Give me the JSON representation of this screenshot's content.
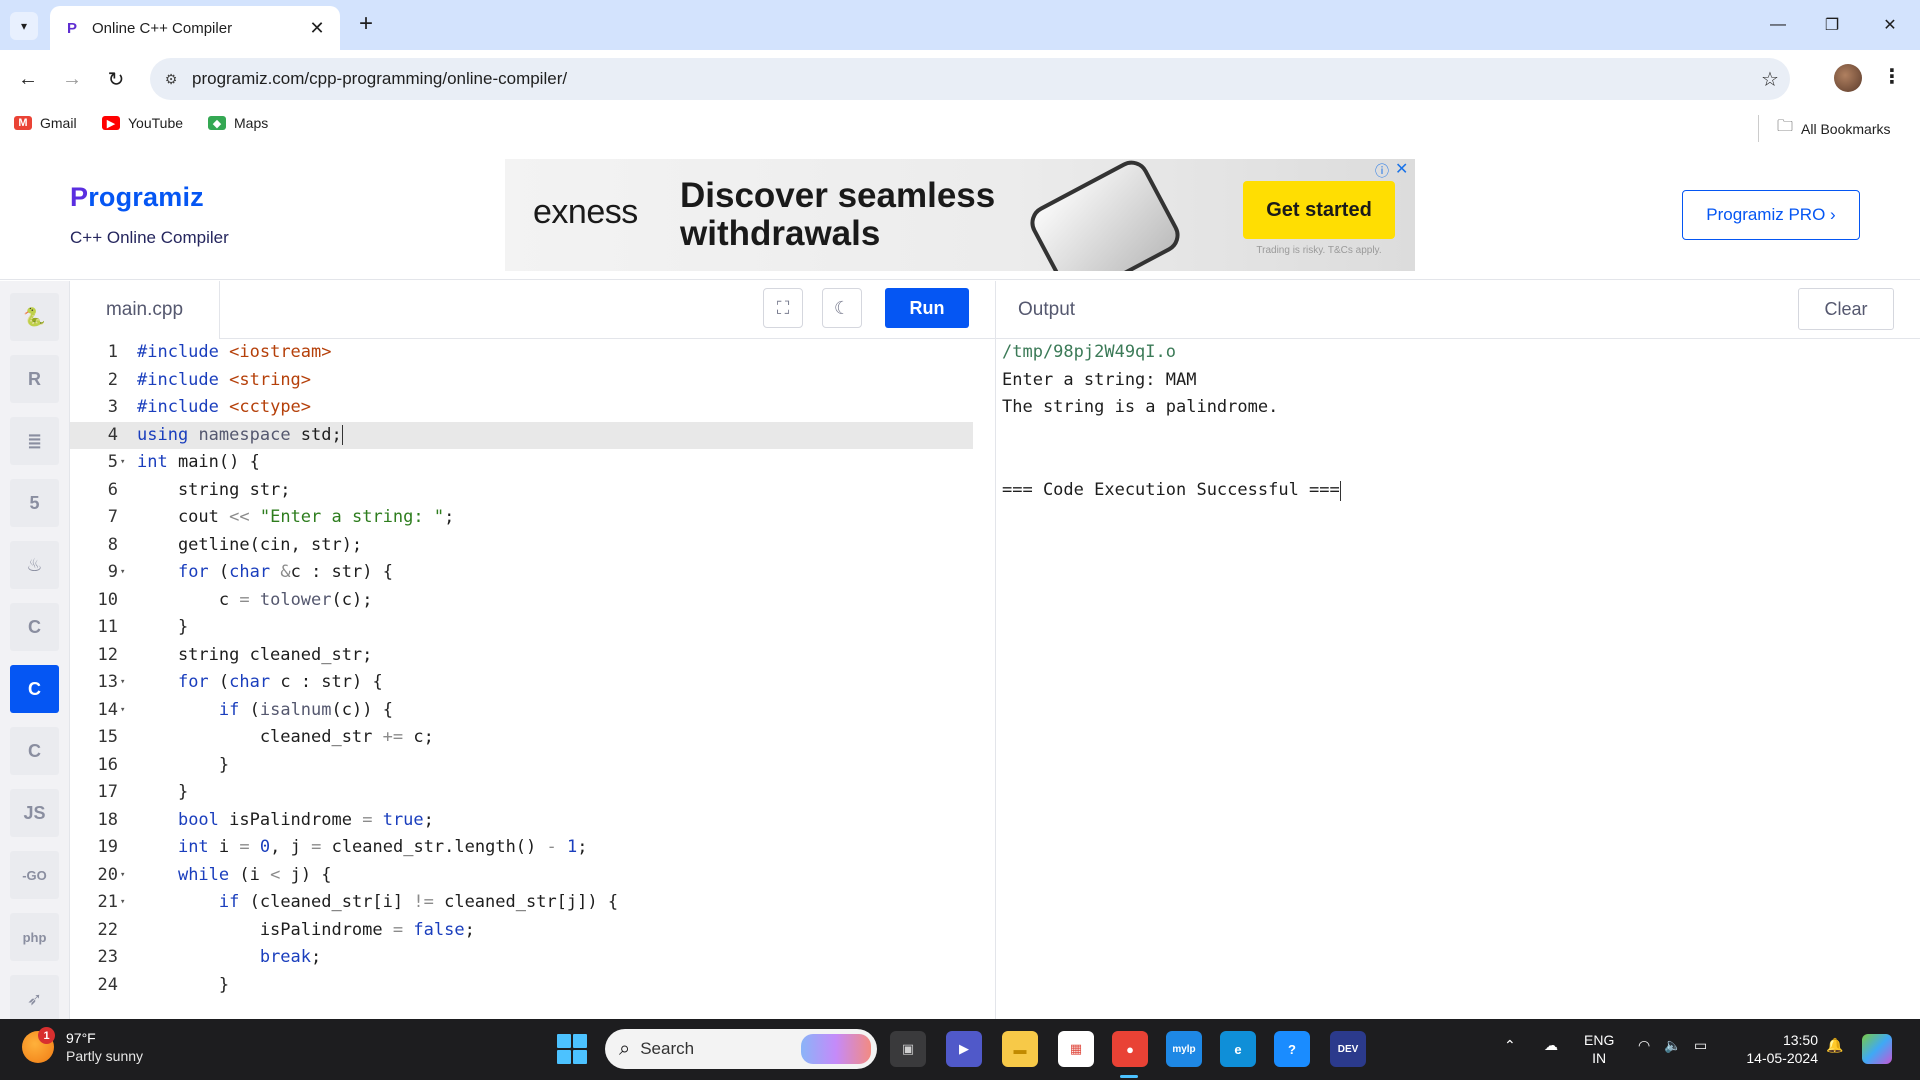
{
  "browser": {
    "tab_title": "Online C++ Compiler",
    "tab_close": "✕",
    "new_tab": "+",
    "url": "programiz.com/cpp-programming/online-compiler/",
    "bookmarks": [
      {
        "label": "Gmail",
        "icon": "gmail-icon",
        "color": "#ea4335"
      },
      {
        "label": "YouTube",
        "icon": "youtube-icon",
        "color": "#ff0000"
      },
      {
        "label": "Maps",
        "icon": "maps-icon",
        "color": "#34a853"
      }
    ],
    "all_bookmarks": "All Bookmarks"
  },
  "site": {
    "logo": "rogramiz",
    "logo_p": "P",
    "subtitle": "C++ Online Compiler",
    "pro_button": "Programiz PRO ›",
    "accent": "#0556f3"
  },
  "ad": {
    "brand": "exness",
    "headline": "Discover seamless withdrawals",
    "cta": "Get started",
    "disclaimer": "Trading is risky. T&Cs apply.",
    "cta_color": "#ffde02"
  },
  "languages": [
    {
      "name": "python",
      "icon": "python-icon",
      "glyph": "🐍"
    },
    {
      "name": "r",
      "icon": "r-icon",
      "glyph": "R"
    },
    {
      "name": "sql",
      "icon": "database-icon",
      "glyph": "≣"
    },
    {
      "name": "html",
      "icon": "html5-icon",
      "glyph": "5"
    },
    {
      "name": "java",
      "icon": "java-icon",
      "glyph": "♨"
    },
    {
      "name": "c",
      "icon": "c-icon",
      "glyph": "C"
    },
    {
      "name": "cpp",
      "icon": "cpp-icon",
      "glyph": "C",
      "active": true
    },
    {
      "name": "csharp",
      "icon": "csharp-icon",
      "glyph": "C"
    },
    {
      "name": "js",
      "icon": "js-icon",
      "glyph": "JS"
    },
    {
      "name": "go",
      "icon": "go-icon",
      "glyph": "-GO"
    },
    {
      "name": "php",
      "icon": "php-icon",
      "glyph": "php"
    },
    {
      "name": "swift",
      "icon": "swift-icon",
      "glyph": "➶"
    }
  ],
  "editor": {
    "file_name": "main.cpp",
    "run_label": "Run",
    "active_line": 4,
    "lines": [
      {
        "n": "1",
        "fold": false,
        "html": "<span class=\"dir\">#include</span> <span class=\"str\">&lt;iostream&gt;</span>"
      },
      {
        "n": "2",
        "fold": false,
        "html": "<span class=\"dir\">#include</span> <span class=\"str\">&lt;string&gt;</span>"
      },
      {
        "n": "3",
        "fold": false,
        "html": "<span class=\"dir\">#include</span> <span class=\"str\">&lt;cctype&gt;</span>"
      },
      {
        "n": "4",
        "fold": false,
        "html": "<span class=\"kw\">using</span> <span class=\"fn\">namespace</span> std;<span class=\"caret\"></span>"
      },
      {
        "n": "5",
        "fold": true,
        "html": "<span class=\"kw\">int</span> main() {"
      },
      {
        "n": "6",
        "fold": false,
        "html": "    string str;"
      },
      {
        "n": "7",
        "fold": false,
        "html": "    cout <span class=\"op\">&lt;&lt;</span> <span class=\"strg\">\"Enter a string: \"</span>;"
      },
      {
        "n": "8",
        "fold": false,
        "html": "    getline(cin, str);"
      },
      {
        "n": "9",
        "fold": true,
        "html": "    <span class=\"kw\">for</span> (<span class=\"kw\">char</span> <span class=\"op\">&amp;</span>c : str) {"
      },
      {
        "n": "10",
        "fold": false,
        "html": "        c <span class=\"op\">=</span> <span class=\"fn\">tolower</span>(c);"
      },
      {
        "n": "11",
        "fold": false,
        "html": "    }"
      },
      {
        "n": "12",
        "fold": false,
        "html": "    string cleaned_str;"
      },
      {
        "n": "13",
        "fold": true,
        "html": "    <span class=\"kw\">for</span> (<span class=\"kw\">char</span> c : str) {"
      },
      {
        "n": "14",
        "fold": true,
        "html": "        <span class=\"kw\">if</span> (<span class=\"fn\">isalnum</span>(c)) {"
      },
      {
        "n": "15",
        "fold": false,
        "html": "            cleaned_str <span class=\"op\">+=</span> c;"
      },
      {
        "n": "16",
        "fold": false,
        "html": "        }"
      },
      {
        "n": "17",
        "fold": false,
        "html": "    }"
      },
      {
        "n": "18",
        "fold": false,
        "html": "    <span class=\"kw\">bool</span> isPalindrome <span class=\"op\">=</span> <span class=\"kw\">true</span>;"
      },
      {
        "n": "19",
        "fold": false,
        "html": "    <span class=\"kw\">int</span> i <span class=\"op\">=</span> <span class=\"num\">0</span>, j <span class=\"op\">=</span> cleaned_str.length() <span class=\"op\">-</span> <span class=\"num\">1</span>;"
      },
      {
        "n": "20",
        "fold": true,
        "html": "    <span class=\"kw\">while</span> (i <span class=\"op\">&lt;</span> j) {"
      },
      {
        "n": "21",
        "fold": true,
        "html": "        <span class=\"kw\">if</span> (cleaned_str[i] <span class=\"op\">!=</span> cleaned_str[j]) {"
      },
      {
        "n": "22",
        "fold": false,
        "html": "            isPalindrome <span class=\"op\">=</span> <span class=\"kw\">false</span>;"
      },
      {
        "n": "23",
        "fold": false,
        "html": "            <span class=\"kw\">break</span>;"
      },
      {
        "n": "24",
        "fold": false,
        "html": "        }"
      }
    ]
  },
  "output": {
    "title": "Output",
    "clear_label": "Clear",
    "lines": [
      {
        "text": "/tmp/98pj2W49qI.o",
        "path": true
      },
      {
        "text": "Enter a string: MAM",
        "path": false
      },
      {
        "text": "The string is a palindrome.",
        "path": false
      },
      {
        "text": "",
        "path": false
      },
      {
        "text": "",
        "path": false
      },
      {
        "text": "=== Code Execution Successful ===",
        "path": false
      }
    ]
  },
  "taskbar": {
    "weather_badge": "1",
    "temperature": "97°F",
    "weather": "Partly sunny",
    "search_placeholder": "Search",
    "apps": [
      {
        "name": "task-view",
        "icon": "task-view-icon",
        "glyph": "▣",
        "bg": "#3a3a3c",
        "fg": "#cfcfcf"
      },
      {
        "name": "teams",
        "icon": "teams-icon",
        "glyph": "▶",
        "bg": "#5059c9",
        "fg": "#ffffff"
      },
      {
        "name": "file-explorer",
        "icon": "folder-icon",
        "glyph": "▬",
        "bg": "#f7c948",
        "fg": "#c18a00"
      },
      {
        "name": "store",
        "icon": "store-icon",
        "glyph": "▦",
        "bg": "#ffffff",
        "fg": "#e04a3f"
      },
      {
        "name": "chrome",
        "icon": "chrome-icon",
        "glyph": "●",
        "bg": "#e94235",
        "fg": "#ffffff"
      },
      {
        "name": "mylp",
        "icon": "mylp-icon",
        "glyph": "mylp",
        "bg": "#1e88e5",
        "fg": "#ffffff"
      },
      {
        "name": "edge",
        "icon": "edge-icon",
        "glyph": "e",
        "bg": "#0f8fd8",
        "fg": "#ffffff"
      },
      {
        "name": "get-help",
        "icon": "help-icon",
        "glyph": "?",
        "bg": "#1a8cff",
        "fg": "#ffffff"
      },
      {
        "name": "dev-home",
        "icon": "dev-home-icon",
        "glyph": "DEV",
        "bg": "#2b3a8c",
        "fg": "#ffffff"
      }
    ],
    "language_1": "ENG",
    "language_2": "IN",
    "time": "13:50",
    "date": "14-05-2024"
  }
}
